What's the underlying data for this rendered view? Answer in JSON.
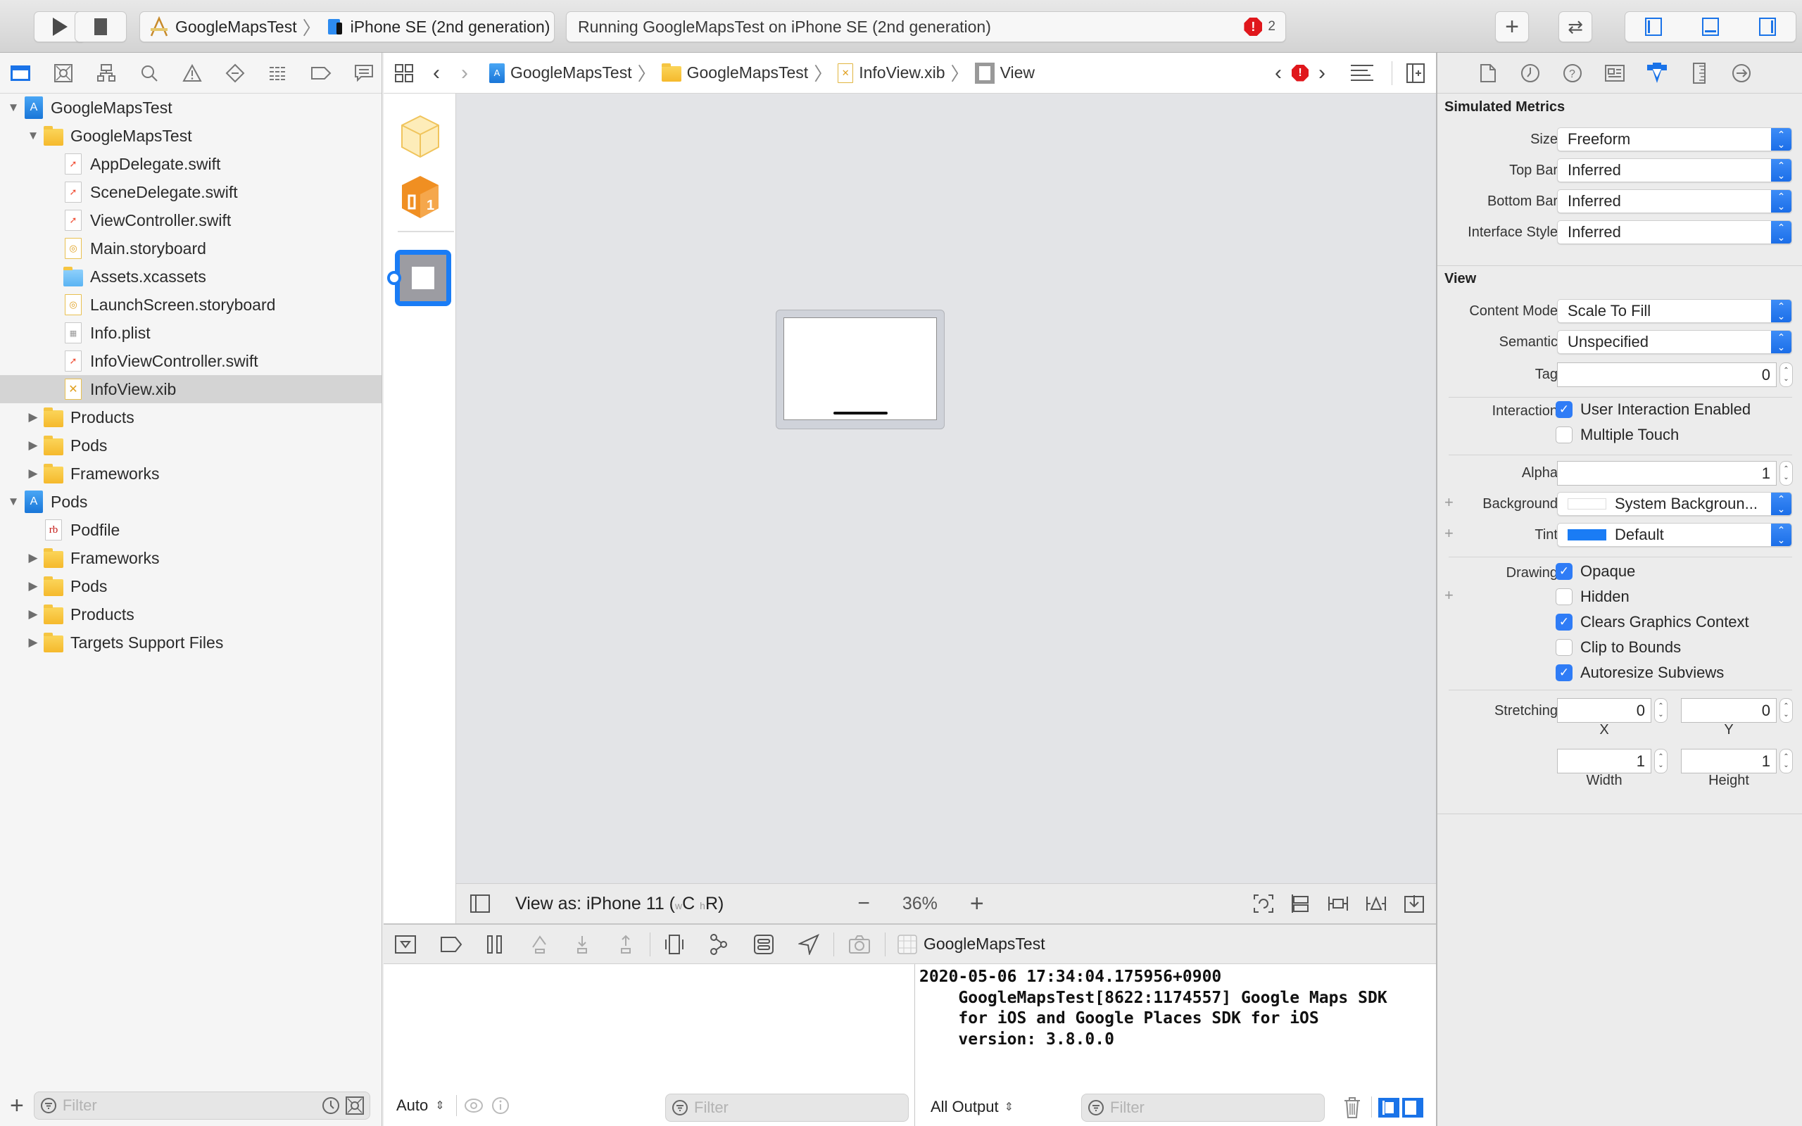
{
  "toolbar": {
    "run_label": "Run",
    "stop_label": "Stop",
    "scheme": "GoogleMapsTest",
    "destination": "iPhone SE (2nd generation)",
    "status": "Running GoogleMapsTest on iPhone SE (2nd generation)",
    "error_count": "2",
    "accent": "#1a73e8",
    "error_color": "#e0171c"
  },
  "navigator": {
    "tabs": [
      "project-navigator",
      "source-control",
      "symbol-navigator",
      "find-navigator",
      "issue-navigator",
      "test-navigator",
      "debug-navigator",
      "breakpoint-navigator",
      "report-navigator"
    ],
    "items": [
      {
        "label": "GoogleMapsTest",
        "type": "project",
        "level": 0,
        "disclosure": "open"
      },
      {
        "label": "GoogleMapsTest",
        "type": "folder",
        "level": 1,
        "disclosure": "open"
      },
      {
        "label": "AppDelegate.swift",
        "type": "swift",
        "level": 2
      },
      {
        "label": "SceneDelegate.swift",
        "type": "swift",
        "level": 2
      },
      {
        "label": "ViewController.swift",
        "type": "swift",
        "level": 2
      },
      {
        "label": "Main.storyboard",
        "type": "storyboard",
        "level": 2
      },
      {
        "label": "Assets.xcassets",
        "type": "assets",
        "level": 2
      },
      {
        "label": "LaunchScreen.storyboard",
        "type": "storyboard",
        "level": 2
      },
      {
        "label": "Info.plist",
        "type": "plist",
        "level": 2
      },
      {
        "label": "InfoViewController.swift",
        "type": "swift",
        "level": 2
      },
      {
        "label": "InfoView.xib",
        "type": "xib",
        "level": 2,
        "selected": true
      },
      {
        "label": "Products",
        "type": "folder",
        "level": 1,
        "disclosure": "closed"
      },
      {
        "label": "Pods",
        "type": "folder",
        "level": 1,
        "disclosure": "closed"
      },
      {
        "label": "Frameworks",
        "type": "folder",
        "level": 1,
        "disclosure": "closed"
      },
      {
        "label": "Pods",
        "type": "project",
        "level": 0,
        "disclosure": "open"
      },
      {
        "label": "Podfile",
        "type": "ruby",
        "level": 1
      },
      {
        "label": "Frameworks",
        "type": "folder",
        "level": 1,
        "disclosure": "closed"
      },
      {
        "label": "Pods",
        "type": "folder",
        "level": 1,
        "disclosure": "closed"
      },
      {
        "label": "Products",
        "type": "folder",
        "level": 1,
        "disclosure": "closed"
      },
      {
        "label": "Targets Support Files",
        "type": "folder",
        "level": 1,
        "disclosure": "closed"
      }
    ],
    "filter_placeholder": "Filter"
  },
  "jumpbar": {
    "crumbs": [
      "GoogleMapsTest",
      "GoogleMapsTest",
      "InfoView.xib",
      "View"
    ]
  },
  "canvas": {
    "view_as_prefix": "View as: iPhone 11 (",
    "size_class_w": "w",
    "size_class_w_val": "C",
    "size_class_h": "h",
    "size_class_h_val": "R)",
    "zoom": "36%",
    "zoom_out": "−",
    "zoom_in": "+"
  },
  "debug": {
    "process": "GoogleMapsTest",
    "console_text": "2020-05-06 17:34:04.175956+0900\n    GoogleMapsTest[8622:1174557] Google Maps SDK\n    for iOS and Google Places SDK for iOS\n    version: 3.8.0.0",
    "variables_mode": "Auto",
    "output_mode": "All Output",
    "filter_placeholder": "Filter"
  },
  "inspector": {
    "simulated_metrics": {
      "title": "Simulated Metrics",
      "rows": [
        {
          "label": "Size",
          "value": "Freeform"
        },
        {
          "label": "Top Bar",
          "value": "Inferred"
        },
        {
          "label": "Bottom Bar",
          "value": "Inferred"
        },
        {
          "label": "Interface Style",
          "value": "Inferred"
        }
      ]
    },
    "view": {
      "title": "View",
      "content_mode_label": "Content Mode",
      "content_mode": "Scale To Fill",
      "semantic_label": "Semantic",
      "semantic": "Unspecified",
      "tag_label": "Tag",
      "tag": "0",
      "interaction_label": "Interaction",
      "user_interaction_label": "User Interaction Enabled",
      "user_interaction": true,
      "multiple_touch_label": "Multiple Touch",
      "multiple_touch": false,
      "alpha_label": "Alpha",
      "alpha": "1",
      "background_label": "Background",
      "background": "System Backgroun...",
      "background_color": "#ffffff",
      "tint_label": "Tint",
      "tint": "Default",
      "tint_color": "#1a7cf5",
      "drawing_label": "Drawing",
      "opaque_label": "Opaque",
      "opaque": true,
      "hidden_label": "Hidden",
      "hidden": false,
      "clears_label": "Clears Graphics Context",
      "clears": true,
      "clip_label": "Clip to Bounds",
      "clip": false,
      "autoresize_label": "Autoresize Subviews",
      "autoresize": true,
      "stretching_label": "Stretching",
      "stretch_x": "0",
      "stretch_y": "0",
      "stretch_w": "1",
      "stretch_h": "1",
      "x_label": "X",
      "y_label": "Y",
      "width_label": "Width",
      "height_label": "Height"
    }
  }
}
